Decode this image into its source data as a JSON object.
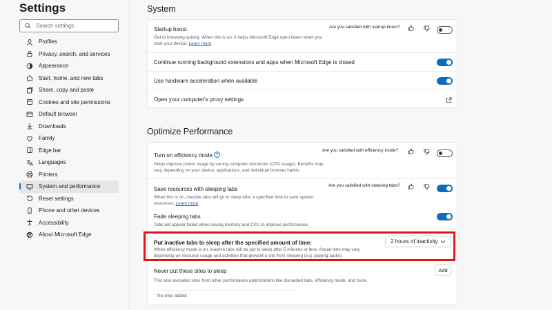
{
  "sidebar": {
    "title": "Settings",
    "search_placeholder": "Search settings",
    "items": [
      {
        "label": "Profiles",
        "icon": "profile-icon"
      },
      {
        "label": "Privacy, search, and services",
        "icon": "lock-icon"
      },
      {
        "label": "Appearance",
        "icon": "appearance-icon"
      },
      {
        "label": "Start, home, and new tabs",
        "icon": "home-icon"
      },
      {
        "label": "Share, copy and paste",
        "icon": "share-icon"
      },
      {
        "label": "Cookies and site permissions",
        "icon": "cookie-icon"
      },
      {
        "label": "Default browser",
        "icon": "browser-icon"
      },
      {
        "label": "Downloads",
        "icon": "download-icon"
      },
      {
        "label": "Family",
        "icon": "family-icon"
      },
      {
        "label": "Edge bar",
        "icon": "edge-bar-icon"
      },
      {
        "label": "Languages",
        "icon": "languages-icon"
      },
      {
        "label": "Printers",
        "icon": "printer-icon"
      },
      {
        "label": "System and performance",
        "icon": "monitor-icon",
        "active": true
      },
      {
        "label": "Reset settings",
        "icon": "reset-icon"
      },
      {
        "label": "Phone and other devices",
        "icon": "phone-icon"
      },
      {
        "label": "Accessibility",
        "icon": "accessibility-icon"
      },
      {
        "label": "About Microsoft Edge",
        "icon": "edge-logo-icon"
      }
    ]
  },
  "system": {
    "title": "System",
    "startup_boost": {
      "title": "Startup boost",
      "desc": "Get to browsing quickly. When this is on, it helps Microsoft Edge open faster when you start your device.",
      "link": "Learn more",
      "feedback": "Are you satisfied with startup boost?",
      "toggle": "off"
    },
    "background": {
      "title": "Continue running background extensions and apps when Microsoft Edge is closed",
      "toggle": "on"
    },
    "hardware": {
      "title": "Use hardware acceleration when available",
      "toggle": "on"
    },
    "proxy": {
      "title": "Open your computer's proxy settings"
    }
  },
  "performance": {
    "title": "Optimize Performance",
    "efficiency": {
      "title": "Turn on efficiency mode",
      "desc": "Helps improve power usage by saving computer resources (CPU usage). Benefits may vary depending on your device, applications, and individual browser habits.",
      "feedback": "Are you satisfied with efficiency mode?",
      "toggle": "off"
    },
    "sleeping": {
      "title": "Save resources with sleeping tabs",
      "desc": "When this is on, inactive tabs will go to sleep after a specified time to save system resources.",
      "link": "Learn more",
      "feedback": "Are you satisfied with sleeping tabs?",
      "toggle": "on"
    },
    "fade": {
      "title": "Fade sleeping tabs",
      "desc": "Tabs will appear faded when saving memory and CPU to improve performance.",
      "toggle": "on"
    },
    "inactive": {
      "title": "Put inactive tabs to sleep after the specified amount of time:",
      "desc": "When efficiency mode is on, inactive tabs will be put to sleep after 5 minutes or less. Actual time may vary depending on resource usage and activities that prevent a site from sleeping (e.g. playing audio).",
      "dropdown_value": "2 hours of inactivity"
    },
    "never_sleep": {
      "title": "Never put these sites to sleep",
      "desc": "This also excludes sites from other performance optimizations like discarded tabs, efficiency mode, and more.",
      "add_label": "Add",
      "empty": "No sites added"
    }
  },
  "colors": {
    "accent": "#0f6cbd",
    "highlight": "#e11218"
  }
}
